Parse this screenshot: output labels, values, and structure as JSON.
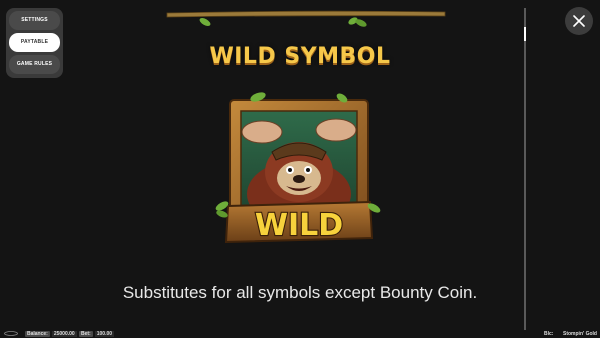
{
  "menu": {
    "items": [
      {
        "label": "SETTINGS",
        "active": false
      },
      {
        "label": "PAYTABLE",
        "active": true
      },
      {
        "label": "GAME RULES",
        "active": false
      }
    ]
  },
  "close_icon": "close-x-icon",
  "paytable": {
    "title": "WILD SYMBOL",
    "symbol_label": "WILD",
    "description": "Substitutes for all symbols except Bounty Coin."
  },
  "status": {
    "balance_label": "Balance:",
    "balance_value": "25000.00",
    "bet_label": "Bet:",
    "bet_value": "100.00",
    "right_text_1": "Blc:",
    "right_text_2": "Stompin' Gold"
  },
  "colors": {
    "background": "#141414",
    "title": "#f6c84a",
    "wood": "#8a5a24",
    "leaf": "#6fae3a"
  }
}
